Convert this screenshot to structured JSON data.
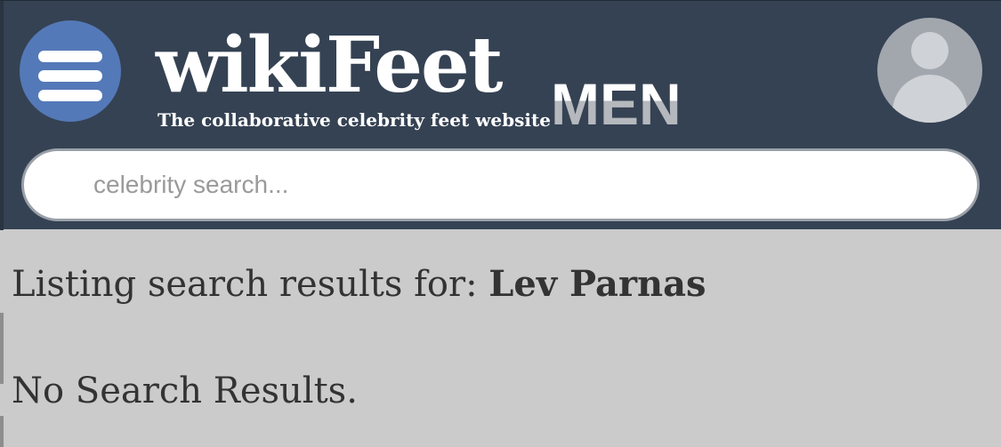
{
  "header": {
    "logo": {
      "word": "wikiFeet",
      "suffix": "MEN",
      "tagline": "The collaborative celebrity feet website"
    },
    "menu_icon": "hamburger-menu-icon",
    "avatar_icon": "user-avatar-icon"
  },
  "search": {
    "placeholder": "celebrity search...",
    "value": ""
  },
  "results": {
    "prefix": "Listing search results for: ",
    "query": "Lev Parnas",
    "empty_message": "No Search Results."
  },
  "colors": {
    "header_bg": "#354253",
    "menu_button_bg": "#5479b8",
    "page_bg": "#cbcbcb",
    "avatar_bg": "#a2a7ae"
  }
}
